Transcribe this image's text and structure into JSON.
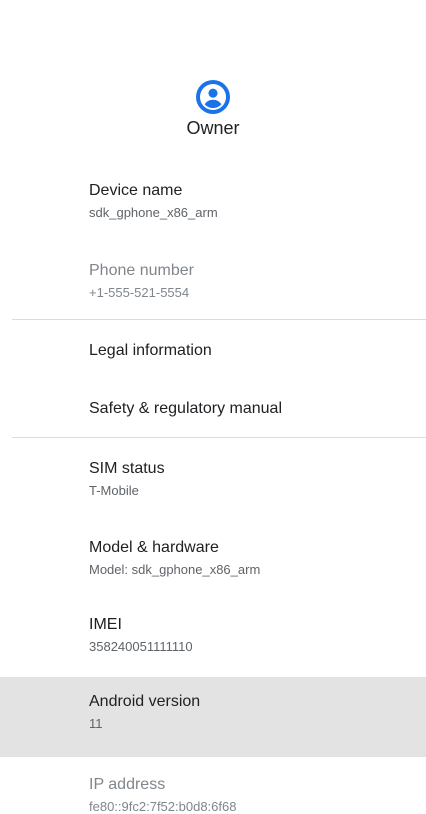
{
  "header": {
    "owner_label": "Owner",
    "avatar_icon": "account-circle-icon",
    "accent_color": "#1a73e8"
  },
  "items": [
    {
      "title": "Device name",
      "summary": "sdk_gphone_x86_arm"
    },
    {
      "title": "Phone number",
      "summary": "+1-555-521-5554"
    },
    {
      "title": "Legal information"
    },
    {
      "title": "Safety & regulatory manual"
    },
    {
      "title": "SIM status",
      "summary": "T-Mobile"
    },
    {
      "title": "Model & hardware",
      "summary": "Model: sdk_gphone_x86_arm"
    },
    {
      "title": "IMEI",
      "summary": "358240051111110"
    },
    {
      "title": "Android version",
      "summary": "11"
    },
    {
      "title": "IP address",
      "summary": "fe80::9fc2:7f52:b0d8:6f68"
    }
  ]
}
